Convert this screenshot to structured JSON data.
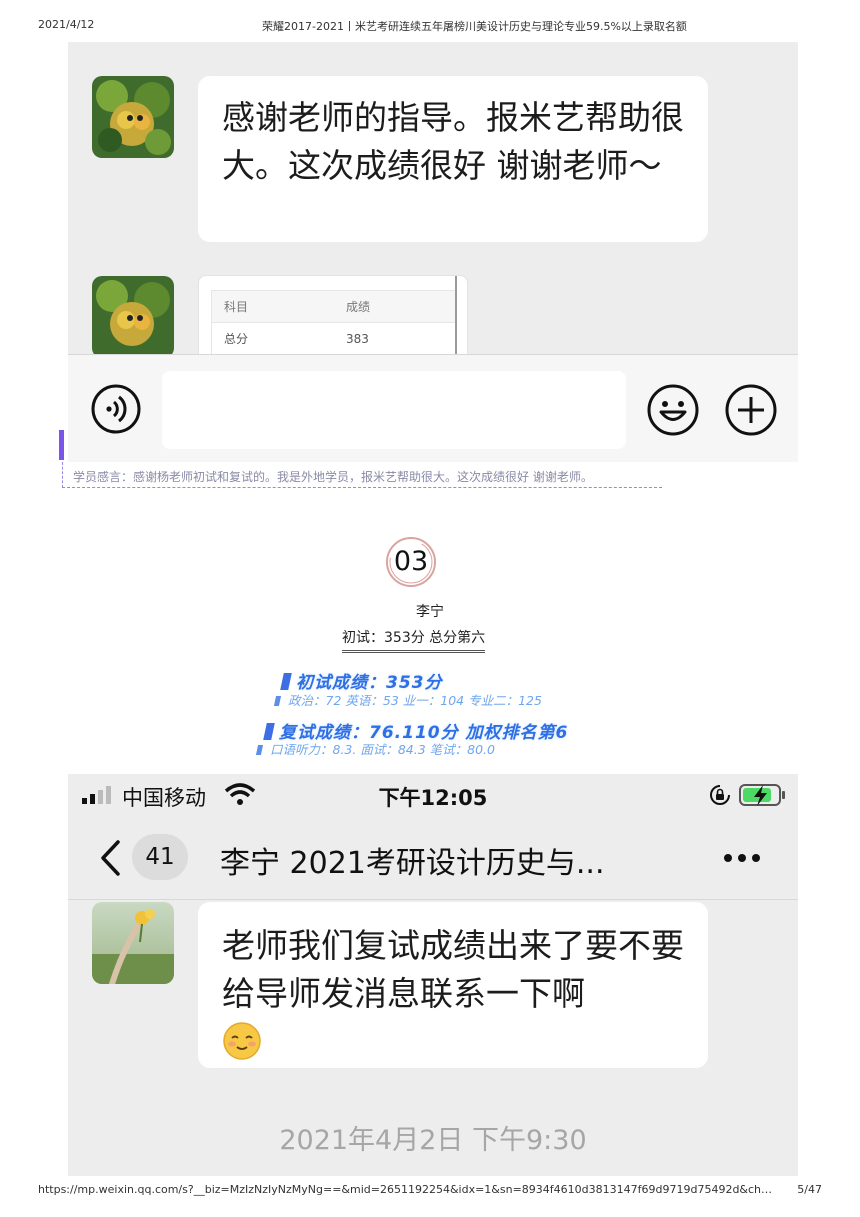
{
  "print_header": {
    "date": "2021/4/12",
    "title": "荣耀2017-2021丨米艺考研连续五年屠榜川美设计历史与理论专业59.5%以上录取名额"
  },
  "shot1": {
    "message": "感谢老师的指导。报米艺帮助很大。这次成绩很好 谢谢老师～",
    "table": {
      "header": [
        "科目",
        "成绩"
      ],
      "rows": [
        [
          "总分",
          "383"
        ]
      ]
    }
  },
  "caption": "学员感言：感谢杨老师初试和复试的。我是外地学员，报米艺帮助很大。这次成绩很好 谢谢老师。",
  "section": {
    "number": "03",
    "student": "李宁",
    "prelim_summary": "初试：353分 总分第六",
    "prelim_title": "初试成绩：353分",
    "prelim_detail": "政治：72 英语：53 业一：104 专业二：125",
    "retest_title": "复试成绩：76.110分 加权排名第6",
    "retest_detail": "口语听力：8.3. 面试：84.3 笔试：80.0"
  },
  "shot2": {
    "status": {
      "carrier": "中国移动",
      "time": "下午12:05"
    },
    "nav": {
      "unread_count": "41",
      "title": "李宁 2021考研设计历史与..."
    },
    "message": "老师我们复试成绩出来了要不要给导师发消息联系一下啊",
    "emoji_name": "smiling-face-icon",
    "timestamp": "2021年4月2日 下午9:30"
  },
  "print_footer": {
    "url": "https://mp.weixin.qq.com/s?__biz=MzIzNzIyNzMyNg==&mid=2651192254&idx=1&sn=8934f4610d3813147f69d9719d75492d&chksm=f33a8…",
    "page": "5/47"
  },
  "colors": {
    "accent_purple": "#7b55e8",
    "score_blue": "#2f6fe4",
    "chat_bg": "#ededed"
  }
}
